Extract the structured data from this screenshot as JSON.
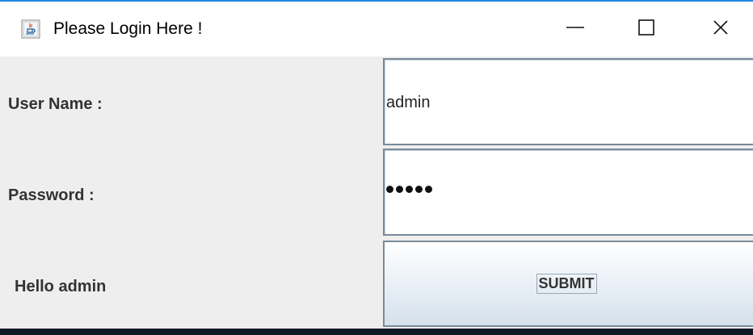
{
  "window": {
    "title": "Please Login Here !",
    "controls": {
      "minimize_icon": "minimize-icon",
      "maximize_icon": "maximize-icon",
      "close_icon": "close-icon"
    },
    "accent_color": "#1e88e5"
  },
  "form": {
    "username_label": "User Name :",
    "username_value": "admin",
    "password_label": "Password :",
    "password_mask_length": 5,
    "greeting": "Hello admin",
    "submit_label": "SUBMIT"
  }
}
